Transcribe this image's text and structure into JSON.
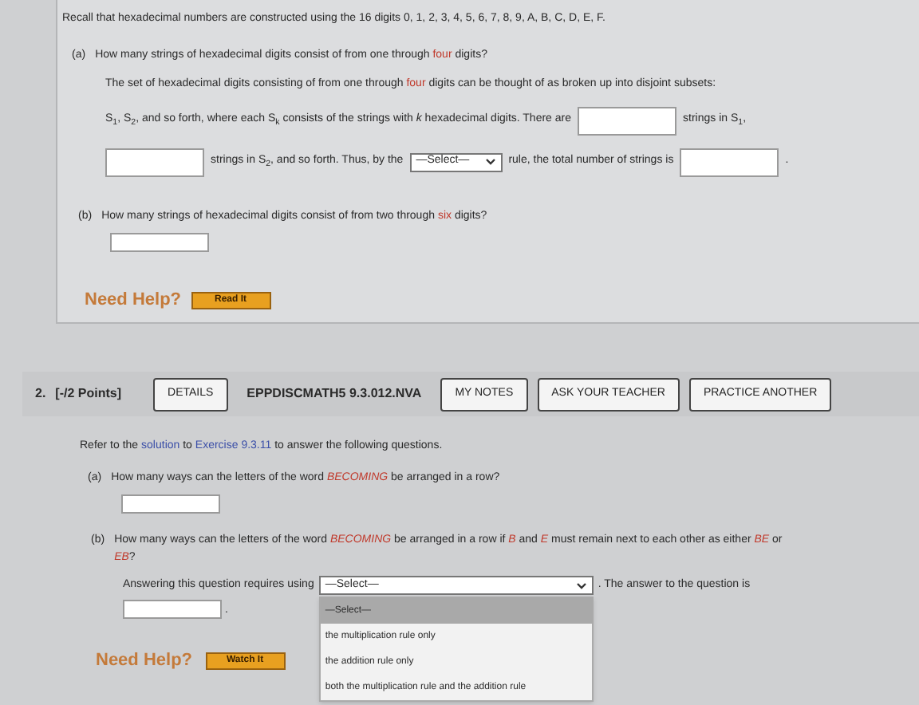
{
  "question1": {
    "intro": [
      {
        "kind": "plain",
        "text": "Recall that hexadecimal numbers are constructed using the 16 digits 0, 1, 2, 3, 4, 5, 6, 7, 8, 9, A, B, C, D, E, F."
      }
    ],
    "part_a": {
      "label": "(a)",
      "question": [
        {
          "kind": "plain",
          "text": "How many strings of hexadecimal digits consist of from one through "
        },
        {
          "kind": "red",
          "text": "four"
        },
        {
          "kind": "plain",
          "text": " digits?"
        }
      ],
      "lines": [
        [
          {
            "kind": "text",
            "segments": [
              {
                "kind": "plain",
                "text": "The set of hexadecimal digits consisting of from one through "
              },
              {
                "kind": "red",
                "text": "four"
              },
              {
                "kind": "plain",
                "text": " digits can be thought of as broken up into disjoint subsets:"
              }
            ]
          }
        ],
        [
          {
            "kind": "text",
            "segments": [
              {
                "kind": "plain",
                "text": "S$_{1}$, S$_{2}$, and so forth, where each S$_{k}$ consists of the strings with *k* hexadecimal digits. There are"
              }
            ]
          },
          {
            "kind": "input"
          },
          {
            "kind": "text",
            "segments": [
              {
                "kind": "plain",
                "text": "strings in S$_{1}$,"
              }
            ]
          }
        ],
        [
          {
            "kind": "input"
          },
          {
            "kind": "text",
            "segments": [
              {
                "kind": "plain",
                "text": "strings in S$_{2}$, and so forth. Thus, by the"
              }
            ]
          },
          {
            "kind": "select",
            "value": "—Select—"
          },
          {
            "kind": "text",
            "segments": [
              {
                "kind": "plain",
                "text": "rule, the total number of strings is"
              }
            ]
          },
          {
            "kind": "input"
          },
          {
            "kind": "text",
            "segments": [
              {
                "kind": "plain",
                "text": "."
              }
            ]
          }
        ]
      ]
    },
    "part_b": {
      "label": "(b)",
      "question": [
        {
          "kind": "plain",
          "text": "How many strings of hexadecimal digits consist of from two through "
        },
        {
          "kind": "red",
          "text": "six"
        },
        {
          "kind": "plain",
          "text": " digits?"
        }
      ]
    },
    "help": {
      "label": "Need Help?",
      "button": "Read It"
    }
  },
  "question2": {
    "number": "2.",
    "points": "[-/2 Points]",
    "details": "DETAILS",
    "code": "EPPDISCMATH5 9.3.012.NVA",
    "buttons": [
      "MY NOTES",
      "ASK YOUR TEACHER",
      "PRACTICE ANOTHER"
    ],
    "intro": [
      {
        "kind": "plain",
        "text": "Refer to the "
      },
      {
        "kind": "link",
        "text": "solution"
      },
      {
        "kind": "plain",
        "text": " to "
      },
      {
        "kind": "link",
        "text": "Exercise 9.3.11"
      },
      {
        "kind": "plain",
        "text": " to answer the following questions."
      }
    ],
    "part_a": {
      "label": "(a)",
      "question": [
        {
          "kind": "plain",
          "text": "How many ways can the letters of the word "
        },
        {
          "kind": "red",
          "text": "*BECOMING*"
        },
        {
          "kind": "plain",
          "text": " be arranged in a row?"
        }
      ]
    },
    "part_b": {
      "label": "(b)",
      "question": [
        {
          "kind": "plain",
          "text": "How many ways can the letters of the word "
        },
        {
          "kind": "red",
          "text": "*BECOMING*"
        },
        {
          "kind": "plain",
          "text": " be arranged in a row if "
        },
        {
          "kind": "red",
          "text": "*B*"
        },
        {
          "kind": "plain",
          "text": " and "
        },
        {
          "kind": "red",
          "text": "*E*"
        },
        {
          "kind": "plain",
          "text": " must remain next to each other as either "
        },
        {
          "kind": "red",
          "text": "*BE*"
        },
        {
          "kind": "plain",
          "text": " or "
        },
        {
          "kind": "red",
          "text": "*EB*"
        },
        {
          "kind": "plain",
          "text": "?"
        }
      ],
      "prompt": "Answering this question requires using",
      "select": {
        "value": "—Select—",
        "open": true,
        "options": [
          {
            "text": "—Select—",
            "selected": true
          },
          {
            "text": "the multiplication rule only",
            "selected": false
          },
          {
            "text": "the addition rule only",
            "selected": false
          },
          {
            "text": "both the multiplication rule and the addition rule",
            "selected": false
          }
        ]
      },
      "after": ". The answer to the question is",
      "end": "."
    },
    "help": {
      "label": "Need Help?",
      "button": "Watch It"
    }
  }
}
